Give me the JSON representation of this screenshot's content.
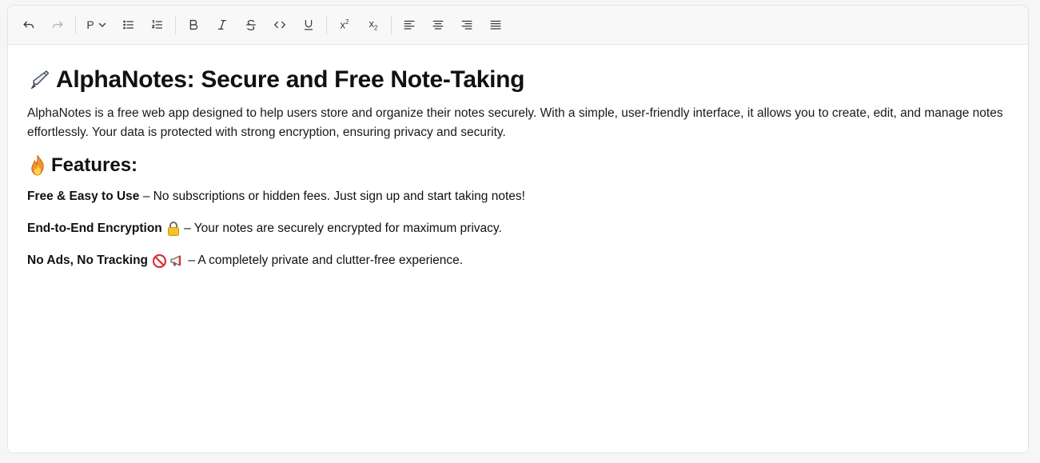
{
  "toolbar": {
    "undo_icon": "undo-icon",
    "redo_icon": "redo-icon",
    "block_type": "P",
    "superscript_label": "x",
    "subscript_label": "x",
    "superscript_mark": "2",
    "subscript_mark": "2"
  },
  "document": {
    "title": "AlphaNotes: Secure and Free Note-Taking",
    "title_emoji": "pen-icon",
    "intro": "AlphaNotes is a free web app designed to help users store and organize their notes securely. With a simple, user-friendly interface, it allows you to create, edit, and manage notes effortlessly. Your data is protected with strong encryption, ensuring privacy and security.",
    "features_heading": "Features:",
    "features_emoji": "fire-icon",
    "features": [
      {
        "title": "Free & Easy to Use",
        "text": " – No subscriptions or hidden fees. Just sign up and start taking notes!"
      },
      {
        "title": "End-to-End Encryption",
        "text": " – Your notes are securely encrypted for maximum privacy."
      },
      {
        "title": "No Ads, No Tracking",
        "text": " – A completely private and clutter-free experience."
      }
    ]
  }
}
